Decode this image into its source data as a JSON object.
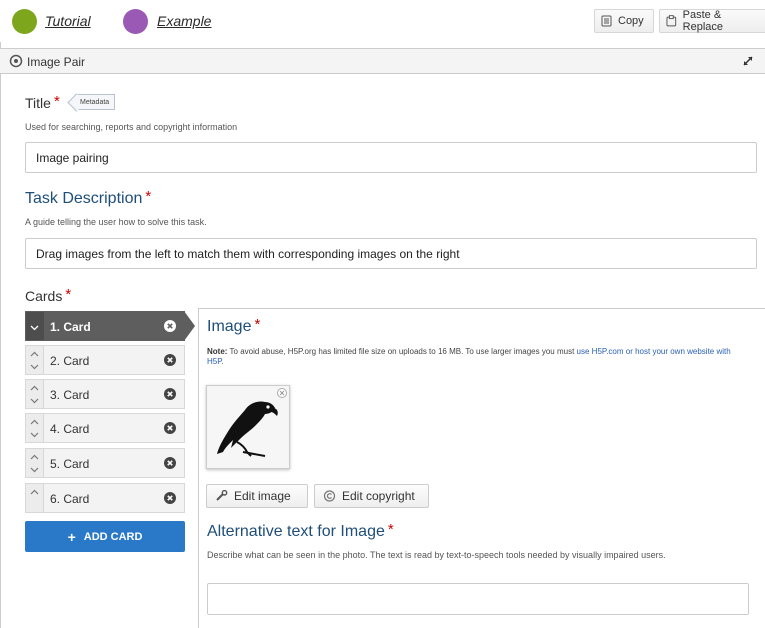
{
  "topbar": {
    "tutorial_label": "Tutorial",
    "example_label": "Example",
    "copy_label": "Copy",
    "paste_label": "Paste & Replace",
    "tutorial_color": "#7ea61d",
    "example_color": "#9b59b6"
  },
  "header": {
    "title": "Image Pair"
  },
  "title_field": {
    "label": "Title",
    "metadata_label": "Metadata",
    "description": "Used for searching, reports and copyright information",
    "value": "Image pairing"
  },
  "task_field": {
    "label": "Task Description",
    "description": "A guide telling the user how to solve this task.",
    "value": "Drag images from the left to match them with corresponding images on the right"
  },
  "cards": {
    "label": "Cards",
    "items": [
      {
        "label": "1. Card"
      },
      {
        "label": "2. Card"
      },
      {
        "label": "3. Card"
      },
      {
        "label": "4. Card"
      },
      {
        "label": "5. Card"
      },
      {
        "label": "6. Card"
      }
    ],
    "add_label": "ADD CARD"
  },
  "image_field": {
    "label": "Image",
    "note_bold": "Note:",
    "note_text": " To avoid abuse, H5P.org has limited file size on uploads to 16 MB. To use larger images you must ",
    "note_link": "use H5P.com or host your own website with H5P",
    "note_end": ".",
    "edit_image_label": "Edit image",
    "edit_copyright_label": "Edit copyright"
  },
  "alt_field": {
    "label": "Alternative text for Image",
    "description": "Describe what can be seen in the photo. The text is read by text-to-speech tools needed by visually impaired users.",
    "value": ""
  }
}
